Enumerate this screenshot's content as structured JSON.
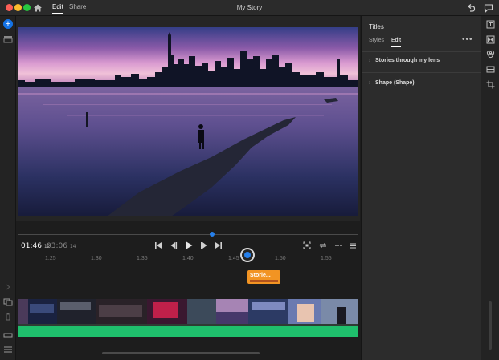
{
  "window": {
    "title": "My Story",
    "menu": [
      {
        "label": "Edit",
        "active": true
      },
      {
        "label": "Share",
        "active": false
      }
    ]
  },
  "player": {
    "current_time": "01:46",
    "current_frames": "12",
    "total_time": "03:06",
    "total_frames": "14",
    "progress_fraction": 0.57
  },
  "timeline": {
    "ruler": [
      "1:25",
      "1:30",
      "1:35",
      "1:40",
      "1:45",
      "1:50",
      "1:55"
    ],
    "title_clip_label": "Storie..."
  },
  "panel": {
    "title": "Titles",
    "tabs": [
      {
        "label": "Styles",
        "active": false
      },
      {
        "label": "Edit",
        "active": true
      }
    ],
    "more_label": "•••",
    "sections": [
      {
        "label": "Stories through my lens"
      },
      {
        "label": "Shape (Shape)"
      }
    ]
  },
  "icons": {
    "home": "home-icon",
    "undo": "undo-icon",
    "chat": "comment-icon"
  },
  "colors": {
    "accent": "#2680eb",
    "title_clip": "#f29423",
    "audio": "#1fbf6c"
  }
}
